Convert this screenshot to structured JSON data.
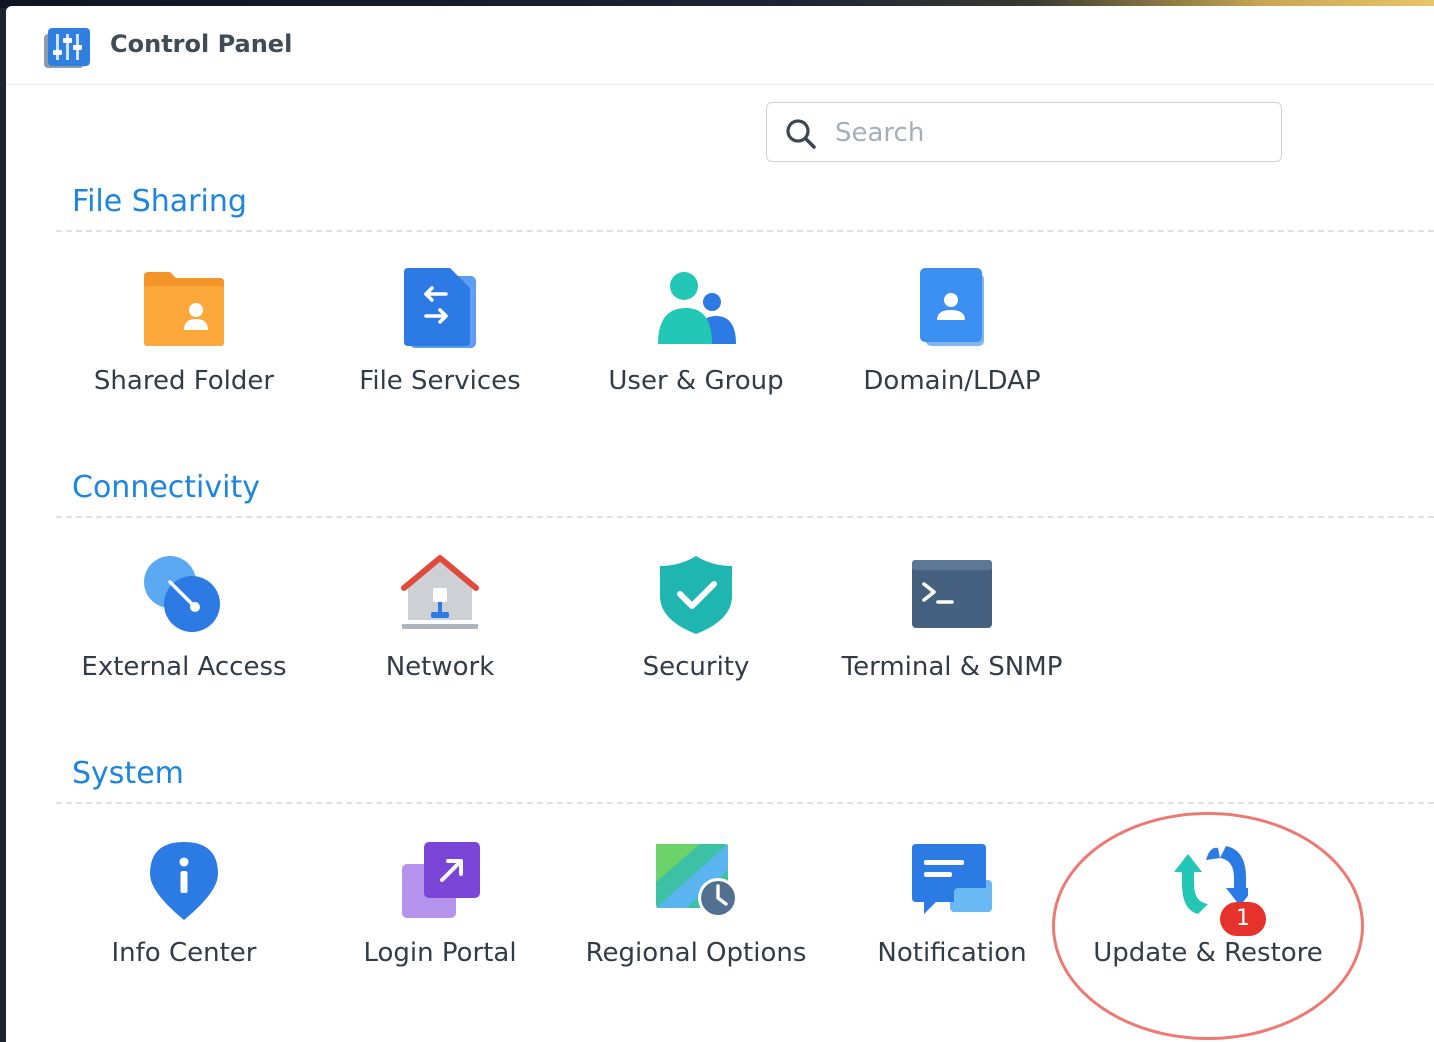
{
  "window": {
    "title": "Control Panel"
  },
  "search": {
    "placeholder": "Search",
    "value": ""
  },
  "sections": {
    "file_sharing": {
      "title": "File Sharing",
      "items": [
        {
          "label": "Shared Folder",
          "icon": "shared-folder-icon"
        },
        {
          "label": "File Services",
          "icon": "file-services-icon"
        },
        {
          "label": "User & Group",
          "icon": "user-group-icon"
        },
        {
          "label": "Domain/LDAP",
          "icon": "domain-ldap-icon"
        }
      ]
    },
    "connectivity": {
      "title": "Connectivity",
      "items": [
        {
          "label": "External Access",
          "icon": "external-access-icon"
        },
        {
          "label": "Network",
          "icon": "network-icon"
        },
        {
          "label": "Security",
          "icon": "security-shield-icon"
        },
        {
          "label": "Terminal & SNMP",
          "icon": "terminal-icon"
        }
      ]
    },
    "system": {
      "title": "System",
      "items": [
        {
          "label": "Info Center",
          "icon": "info-center-icon"
        },
        {
          "label": "Login Portal",
          "icon": "login-portal-icon"
        },
        {
          "label": "Regional Options",
          "icon": "regional-options-icon"
        },
        {
          "label": "Notification",
          "icon": "notification-icon"
        },
        {
          "label": "Update & Restore",
          "icon": "update-restore-icon",
          "badge": "1"
        }
      ]
    }
  },
  "colors": {
    "section_title": "#1b85e0",
    "badge": "#e5322d",
    "highlight": "#ec7a72"
  }
}
